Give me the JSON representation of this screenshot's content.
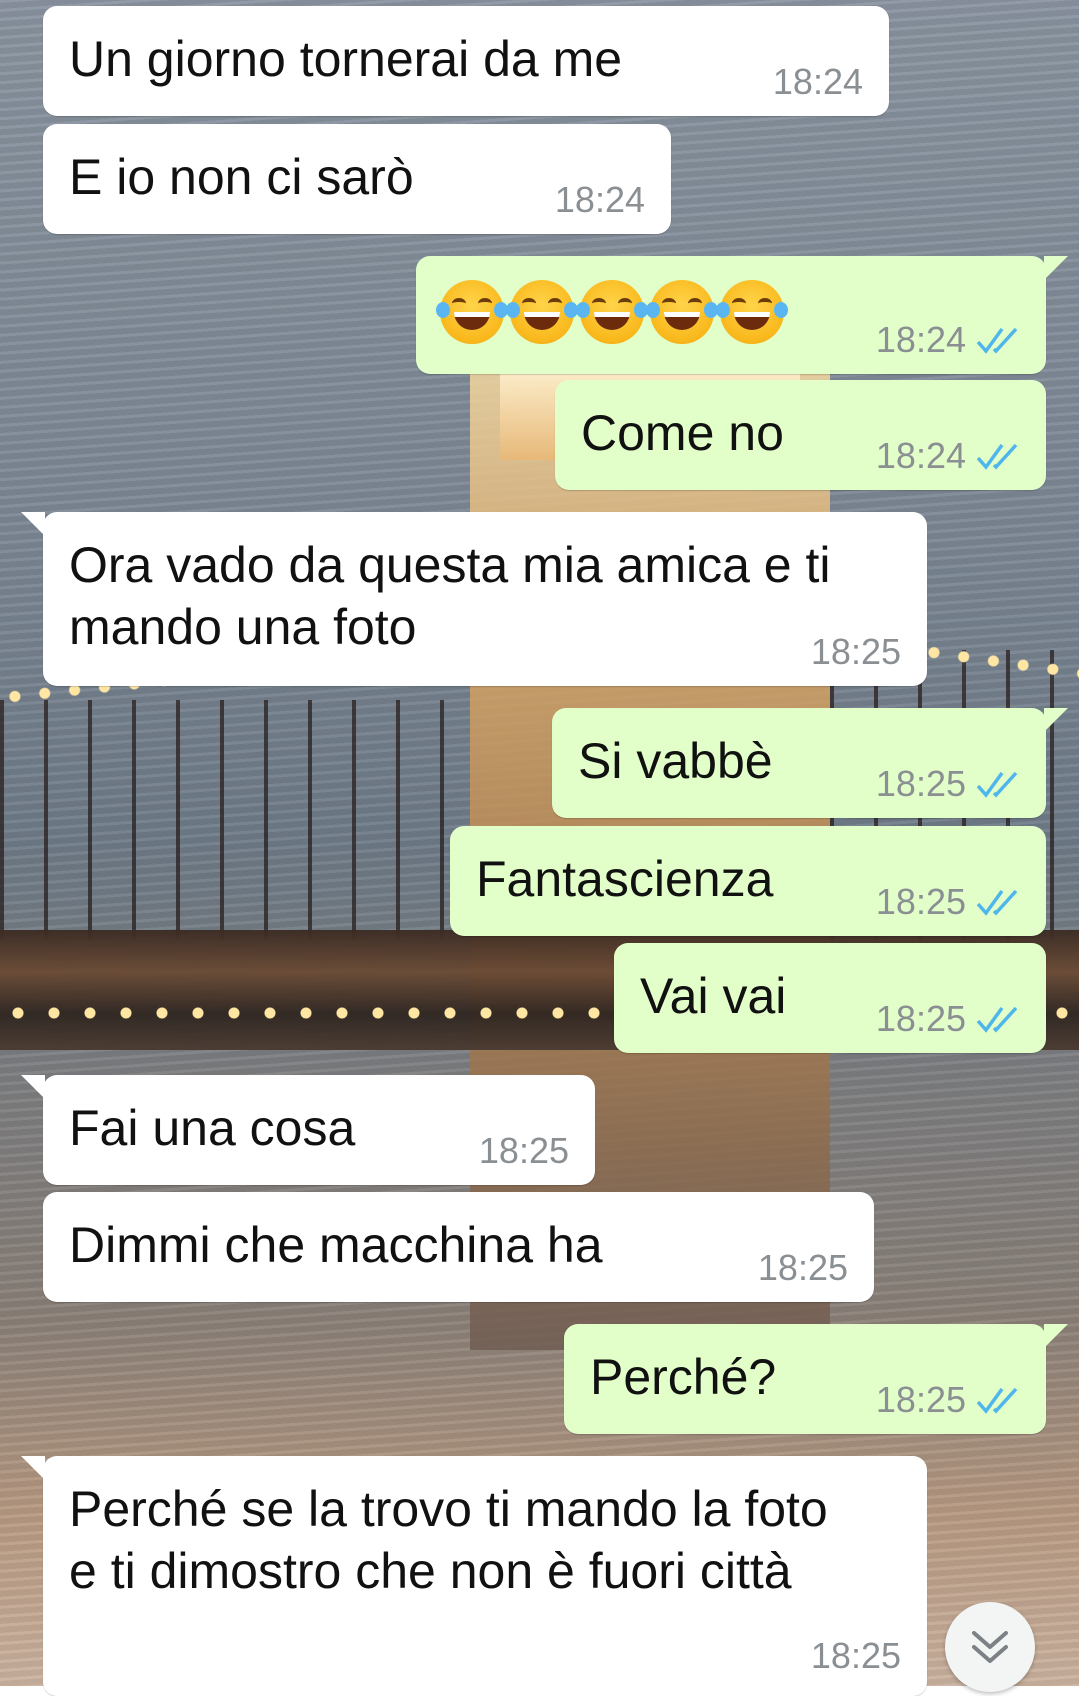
{
  "conversation": {
    "messages": [
      {
        "id": 1,
        "direction": "incoming",
        "text": "Un giorno tornerai da me",
        "time": "18:24"
      },
      {
        "id": 2,
        "direction": "incoming",
        "text": "E io non ci sarò",
        "time": "18:24"
      },
      {
        "id": 3,
        "direction": "outgoing",
        "emoji": "face-with-tears-of-joy",
        "emoji_count": 5,
        "time": "18:24",
        "status": "read"
      },
      {
        "id": 4,
        "direction": "outgoing",
        "text": "Come no",
        "time": "18:24",
        "status": "read"
      },
      {
        "id": 5,
        "direction": "incoming",
        "text": "Ora vado da questa mia amica e ti\nmando una foto",
        "time": "18:25"
      },
      {
        "id": 6,
        "direction": "outgoing",
        "text": "Si vabbè",
        "time": "18:25",
        "status": "read"
      },
      {
        "id": 7,
        "direction": "outgoing",
        "text": "Fantascienza",
        "time": "18:25",
        "status": "read"
      },
      {
        "id": 8,
        "direction": "outgoing",
        "text": "Vai vai",
        "time": "18:25",
        "status": "read"
      },
      {
        "id": 9,
        "direction": "incoming",
        "text": "Fai una cosa",
        "time": "18:25"
      },
      {
        "id": 10,
        "direction": "incoming",
        "text": "Dimmi che macchina ha",
        "time": "18:25"
      },
      {
        "id": 11,
        "direction": "outgoing",
        "text": "Perché?",
        "time": "18:25",
        "status": "read"
      },
      {
        "id": 12,
        "direction": "incoming",
        "text": "Perché se la trovo ti mando la foto\ne ti dimostro che non è fuori città",
        "time": "18:25"
      }
    ]
  },
  "colors": {
    "incoming_bubble": "#ffffff",
    "outgoing_bubble": "#e2fec9",
    "timestamp": "#8a8f93",
    "read_ticks": "#4fb6ec"
  },
  "icons": {
    "read_receipt": "double-check-icon",
    "scroll_down": "chevron-double-down-icon"
  }
}
